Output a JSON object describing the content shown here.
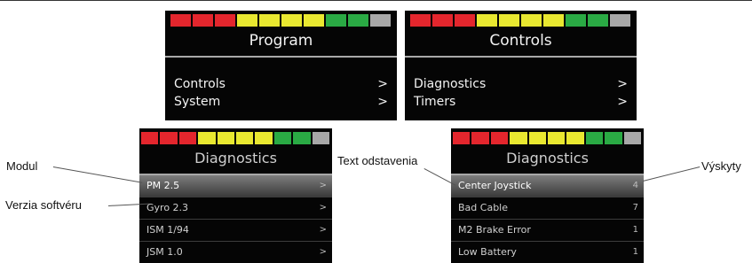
{
  "colors": {
    "gauge": [
      "#e4262d",
      "#e4262d",
      "#e4262d",
      "#e9e830",
      "#e9e830",
      "#e9e830",
      "#e9e830",
      "#2aaa44",
      "#2aaa44",
      "#a8a8a8"
    ]
  },
  "program_screen": {
    "title": "Program",
    "items": [
      {
        "label": "Controls",
        "chevron": ">"
      },
      {
        "label": "System",
        "chevron": ">"
      }
    ]
  },
  "controls_screen": {
    "title": "Controls",
    "items": [
      {
        "label": "Diagnostics",
        "chevron": ">"
      },
      {
        "label": "Timers",
        "chevron": ">"
      }
    ]
  },
  "modules_screen": {
    "title": "Diagnostics",
    "rows": [
      {
        "label": "PM 2.5",
        "value": ">"
      },
      {
        "label": "Gyro 2.3",
        "value": ">"
      },
      {
        "label": "ISM 1/94",
        "value": ">"
      },
      {
        "label": "JSM 1.0",
        "value": ">"
      }
    ]
  },
  "faults_screen": {
    "title": "Diagnostics",
    "rows": [
      {
        "label": "Center Joystick",
        "value": "4"
      },
      {
        "label": "Bad Cable",
        "value": "7"
      },
      {
        "label": "M2 Brake Error",
        "value": "1"
      },
      {
        "label": "Low Battery",
        "value": "1"
      }
    ]
  },
  "callouts": {
    "modul": "Modul",
    "verzia": "Verzia softvéru",
    "text_odstavenia": "Text odstavenia",
    "vyskyty": "Výskyty"
  }
}
